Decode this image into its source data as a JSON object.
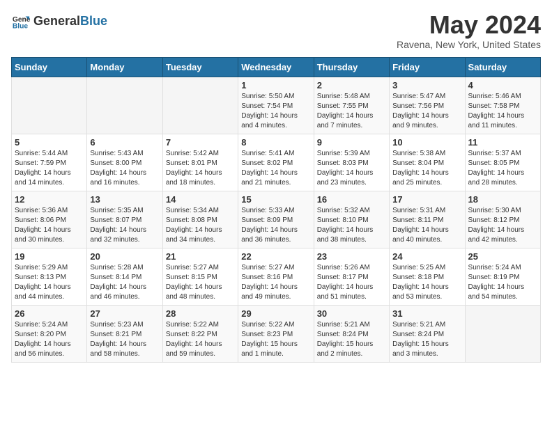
{
  "logo": {
    "general": "General",
    "blue": "Blue"
  },
  "title": "May 2024",
  "subtitle": "Ravena, New York, United States",
  "days_of_week": [
    "Sunday",
    "Monday",
    "Tuesday",
    "Wednesday",
    "Thursday",
    "Friday",
    "Saturday"
  ],
  "weeks": [
    [
      {
        "day": "",
        "info": ""
      },
      {
        "day": "",
        "info": ""
      },
      {
        "day": "",
        "info": ""
      },
      {
        "day": "1",
        "info": "Sunrise: 5:50 AM\nSunset: 7:54 PM\nDaylight: 14 hours and 4 minutes."
      },
      {
        "day": "2",
        "info": "Sunrise: 5:48 AM\nSunset: 7:55 PM\nDaylight: 14 hours and 7 minutes."
      },
      {
        "day": "3",
        "info": "Sunrise: 5:47 AM\nSunset: 7:56 PM\nDaylight: 14 hours and 9 minutes."
      },
      {
        "day": "4",
        "info": "Sunrise: 5:46 AM\nSunset: 7:58 PM\nDaylight: 14 hours and 11 minutes."
      }
    ],
    [
      {
        "day": "5",
        "info": "Sunrise: 5:44 AM\nSunset: 7:59 PM\nDaylight: 14 hours and 14 minutes."
      },
      {
        "day": "6",
        "info": "Sunrise: 5:43 AM\nSunset: 8:00 PM\nDaylight: 14 hours and 16 minutes."
      },
      {
        "day": "7",
        "info": "Sunrise: 5:42 AM\nSunset: 8:01 PM\nDaylight: 14 hours and 18 minutes."
      },
      {
        "day": "8",
        "info": "Sunrise: 5:41 AM\nSunset: 8:02 PM\nDaylight: 14 hours and 21 minutes."
      },
      {
        "day": "9",
        "info": "Sunrise: 5:39 AM\nSunset: 8:03 PM\nDaylight: 14 hours and 23 minutes."
      },
      {
        "day": "10",
        "info": "Sunrise: 5:38 AM\nSunset: 8:04 PM\nDaylight: 14 hours and 25 minutes."
      },
      {
        "day": "11",
        "info": "Sunrise: 5:37 AM\nSunset: 8:05 PM\nDaylight: 14 hours and 28 minutes."
      }
    ],
    [
      {
        "day": "12",
        "info": "Sunrise: 5:36 AM\nSunset: 8:06 PM\nDaylight: 14 hours and 30 minutes."
      },
      {
        "day": "13",
        "info": "Sunrise: 5:35 AM\nSunset: 8:07 PM\nDaylight: 14 hours and 32 minutes."
      },
      {
        "day": "14",
        "info": "Sunrise: 5:34 AM\nSunset: 8:08 PM\nDaylight: 14 hours and 34 minutes."
      },
      {
        "day": "15",
        "info": "Sunrise: 5:33 AM\nSunset: 8:09 PM\nDaylight: 14 hours and 36 minutes."
      },
      {
        "day": "16",
        "info": "Sunrise: 5:32 AM\nSunset: 8:10 PM\nDaylight: 14 hours and 38 minutes."
      },
      {
        "day": "17",
        "info": "Sunrise: 5:31 AM\nSunset: 8:11 PM\nDaylight: 14 hours and 40 minutes."
      },
      {
        "day": "18",
        "info": "Sunrise: 5:30 AM\nSunset: 8:12 PM\nDaylight: 14 hours and 42 minutes."
      }
    ],
    [
      {
        "day": "19",
        "info": "Sunrise: 5:29 AM\nSunset: 8:13 PM\nDaylight: 14 hours and 44 minutes."
      },
      {
        "day": "20",
        "info": "Sunrise: 5:28 AM\nSunset: 8:14 PM\nDaylight: 14 hours and 46 minutes."
      },
      {
        "day": "21",
        "info": "Sunrise: 5:27 AM\nSunset: 8:15 PM\nDaylight: 14 hours and 48 minutes."
      },
      {
        "day": "22",
        "info": "Sunrise: 5:27 AM\nSunset: 8:16 PM\nDaylight: 14 hours and 49 minutes."
      },
      {
        "day": "23",
        "info": "Sunrise: 5:26 AM\nSunset: 8:17 PM\nDaylight: 14 hours and 51 minutes."
      },
      {
        "day": "24",
        "info": "Sunrise: 5:25 AM\nSunset: 8:18 PM\nDaylight: 14 hours and 53 minutes."
      },
      {
        "day": "25",
        "info": "Sunrise: 5:24 AM\nSunset: 8:19 PM\nDaylight: 14 hours and 54 minutes."
      }
    ],
    [
      {
        "day": "26",
        "info": "Sunrise: 5:24 AM\nSunset: 8:20 PM\nDaylight: 14 hours and 56 minutes."
      },
      {
        "day": "27",
        "info": "Sunrise: 5:23 AM\nSunset: 8:21 PM\nDaylight: 14 hours and 58 minutes."
      },
      {
        "day": "28",
        "info": "Sunrise: 5:22 AM\nSunset: 8:22 PM\nDaylight: 14 hours and 59 minutes."
      },
      {
        "day": "29",
        "info": "Sunrise: 5:22 AM\nSunset: 8:23 PM\nDaylight: 15 hours and 1 minute."
      },
      {
        "day": "30",
        "info": "Sunrise: 5:21 AM\nSunset: 8:24 PM\nDaylight: 15 hours and 2 minutes."
      },
      {
        "day": "31",
        "info": "Sunrise: 5:21 AM\nSunset: 8:24 PM\nDaylight: 15 hours and 3 minutes."
      },
      {
        "day": "",
        "info": ""
      }
    ]
  ]
}
